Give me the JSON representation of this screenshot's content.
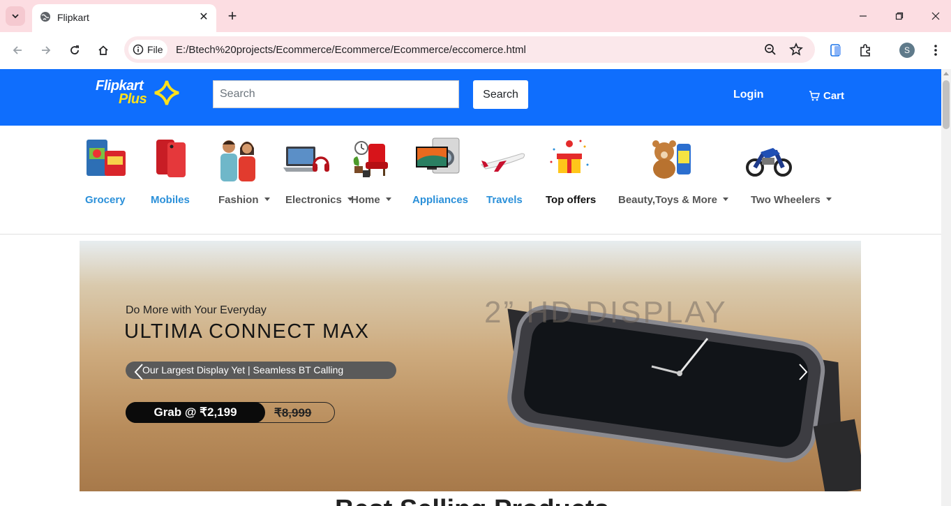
{
  "browser": {
    "tab_title": "Flipkart",
    "url_chip": "File",
    "url": "E:/Btech%20projects/Ecommerce/Ecommerce/Ecommerce/eccomerce.html",
    "profile_initial": "S"
  },
  "header": {
    "logo_line1": "Flipkart",
    "logo_line2": "Plus",
    "search_placeholder": "Search",
    "search_button": "Search",
    "login": "Login",
    "cart": "Cart",
    "brand_color": "#0f6efd"
  },
  "categories": [
    {
      "label": "Grocery",
      "dropdown": false
    },
    {
      "label": "Mobiles",
      "dropdown": false
    },
    {
      "label": "Fashion",
      "dropdown": true
    },
    {
      "label": "Electronics",
      "dropdown": true
    },
    {
      "label": "Home",
      "dropdown": true
    },
    {
      "label": "Appliances",
      "dropdown": false
    },
    {
      "label": "Travels",
      "dropdown": false
    },
    {
      "label": "Top offers",
      "dropdown": false
    },
    {
      "label": "Beauty,Toys & More",
      "dropdown": true
    },
    {
      "label": "Two Wheelers",
      "dropdown": true
    }
  ],
  "banner": {
    "tagline": "Do More with Your Everyday",
    "title": "ULTIMA CONNECT MAX",
    "pill": "Our Largest Display Yet | Seamless BT Calling",
    "price": "Grab @ ₹2,199",
    "old_price": "₹8,999",
    "display_text": "2” HD DISPLAY"
  },
  "section": {
    "title_partial": "Best Selling Products"
  }
}
